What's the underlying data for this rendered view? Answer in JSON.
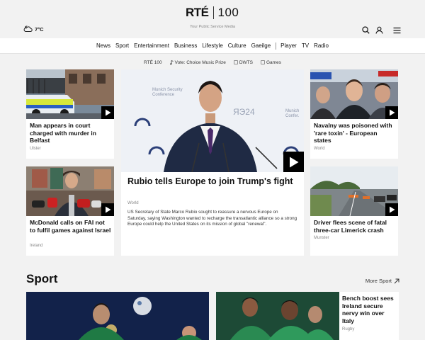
{
  "header": {
    "logo_main": "RTÉ",
    "logo_num": "100",
    "tagline": "Your Public Service Media",
    "weather": "7°C"
  },
  "nav": {
    "items": [
      "News",
      "Sport",
      "Entertainment",
      "Business",
      "Lifestyle",
      "Culture",
      "Gaeilge"
    ],
    "items2": [
      "Player",
      "TV",
      "Radio"
    ]
  },
  "subnav": {
    "items": [
      "RTÉ 100",
      "Vote: Choice Music Prize",
      "DWTS",
      "Games"
    ]
  },
  "cards": {
    "belfast": {
      "title": "Man appears in court charged with murder in Belfast",
      "tag": "Ulster"
    },
    "mcdonald": {
      "title": "McDonald calls on FAI not to fulfil games against Israel",
      "tag": "Ireland"
    },
    "feature": {
      "title": "Rubio tells Europe to join Trump's fight",
      "tag": "World",
      "desc": "US Secretary of State Marco Rubio sought to reassure a nervous Europe on Saturday, saying Washington wanted to recharge the transatlantic alliance so a strong Europe could help the United States on its mission of global \"renewal\"."
    },
    "navalny": {
      "title": "Navalny was poisoned with 'rare toxin' - European states",
      "tag": "World"
    },
    "limerick": {
      "title": "Driver flees scene of fatal three-car Limerick crash",
      "tag": "Munster"
    },
    "bench": {
      "title": "Bench boost sees Ireland secure nervy win over Italy",
      "tag": "Rugby"
    }
  },
  "sport": {
    "title": "Sport",
    "more": "More Sport"
  },
  "colors": {
    "accent_green": "#2e7d4f",
    "background": "#f2f2f2"
  }
}
